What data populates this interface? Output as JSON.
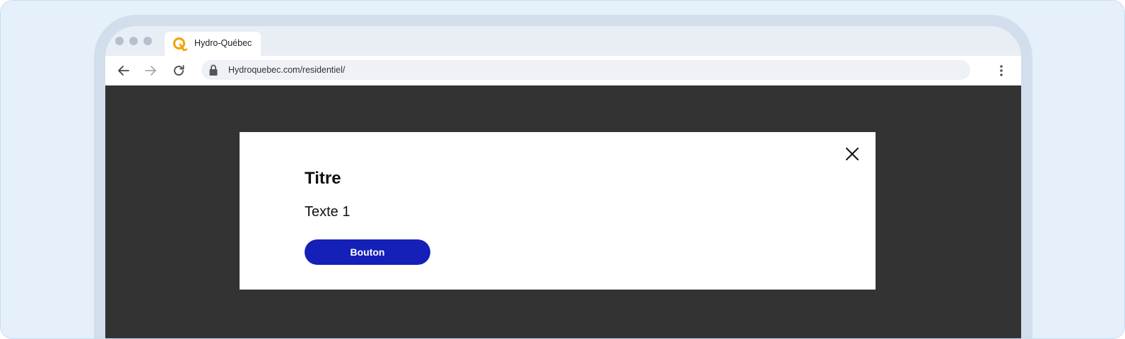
{
  "browser": {
    "tab_title": "Hydro-Québec",
    "url": "Hydroquebec.com/residentiel/",
    "favicon": "hydro-quebec-logo",
    "brand_color": "#f2a100"
  },
  "modal": {
    "title": "Titre",
    "body": "Texte 1",
    "button_label": "Bouton",
    "button_color": "#1420b8"
  },
  "icons": {
    "back": "arrow-left-icon",
    "forward": "arrow-right-icon",
    "reload": "reload-icon",
    "lock": "lock-icon",
    "menu": "kebab-menu-icon",
    "close": "close-icon"
  }
}
